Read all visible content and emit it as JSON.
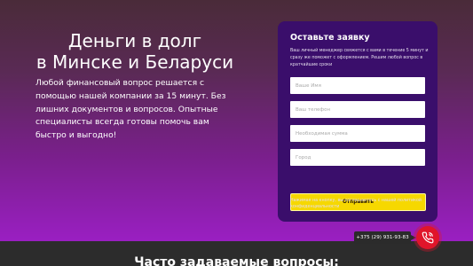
{
  "hero": {
    "title_line1": "Деньги в долг",
    "title_line2": "в Минске и Беларуси",
    "text": "Любой финансовый вопрос решается с помощью нашей компании за 15 минут. Без лишних документов и вопросов. Опытные специалисты всегда готовы помочь вам быстро и выгодно!"
  },
  "form": {
    "title": "Оставьте заявку",
    "description": "Ваш личный менеджер свяжется с вами в течение 5 минут и сразу же поможет с оформлением. Решим любой вопрос в кратчайшие сроки",
    "fields": [
      {
        "placeholder": "Ваше Имя"
      },
      {
        "placeholder": "Ваш телефон"
      },
      {
        "placeholder": "Необходимая сумма"
      },
      {
        "placeholder": "Город"
      }
    ],
    "submit_label": "Отправить",
    "note": "Нажимая на кнопку, вы соглашаетесь с нашей политикой конфиденциальности"
  },
  "faq": {
    "title": "Часто задаваемые вопросы:"
  },
  "contact": {
    "phone": "+375 (29) 931-93-83",
    "call_icon": "phone-icon"
  },
  "colors": {
    "accent_yellow": "#f6d800",
    "form_bg": "#3a0e6b",
    "call_red": "#e0152a",
    "gradient_top": "#4a2b39",
    "gradient_bottom": "#9a1fc2"
  }
}
